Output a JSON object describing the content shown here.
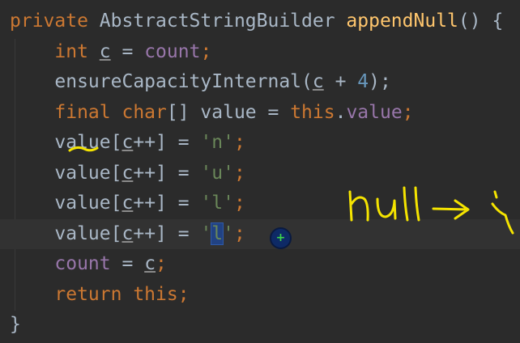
{
  "code": {
    "lines": [
      [
        {
          "t": "private ",
          "c": "kw"
        },
        {
          "t": "AbstractStringBuilder ",
          "c": "plain"
        },
        {
          "t": "appendNull",
          "c": "fn"
        },
        {
          "t": "() {",
          "c": "plain"
        }
      ],
      [
        {
          "t": "    ",
          "c": "plain"
        },
        {
          "t": "int ",
          "c": "kw"
        },
        {
          "t": "c",
          "c": "var"
        },
        {
          "t": " = ",
          "c": "plain"
        },
        {
          "t": "count",
          "c": "field"
        },
        {
          "t": ";",
          "c": "kw"
        }
      ],
      [
        {
          "t": "    ensureCapacityInternal(",
          "c": "plain"
        },
        {
          "t": "c",
          "c": "var"
        },
        {
          "t": " + ",
          "c": "plain"
        },
        {
          "t": "4",
          "c": "num"
        },
        {
          "t": ");",
          "c": "plain"
        }
      ],
      [
        {
          "t": "    ",
          "c": "plain"
        },
        {
          "t": "final char",
          "c": "kw"
        },
        {
          "t": "[] value = ",
          "c": "plain"
        },
        {
          "t": "this",
          "c": "kw"
        },
        {
          "t": ".",
          "c": "plain"
        },
        {
          "t": "value",
          "c": "field"
        },
        {
          "t": ";",
          "c": "kw"
        }
      ],
      [
        {
          "t": "    value[",
          "c": "plain"
        },
        {
          "t": "c",
          "c": "var"
        },
        {
          "t": "++] = ",
          "c": "plain"
        },
        {
          "t": "'n'",
          "c": "str"
        },
        {
          "t": ";",
          "c": "kw"
        }
      ],
      [
        {
          "t": "    value[",
          "c": "plain"
        },
        {
          "t": "c",
          "c": "var"
        },
        {
          "t": "++] = ",
          "c": "plain"
        },
        {
          "t": "'u'",
          "c": "str"
        },
        {
          "t": ";",
          "c": "kw"
        }
      ],
      [
        {
          "t": "    value[",
          "c": "plain"
        },
        {
          "t": "c",
          "c": "var"
        },
        {
          "t": "++] = ",
          "c": "plain"
        },
        {
          "t": "'l'",
          "c": "str"
        },
        {
          "t": ";",
          "c": "kw"
        }
      ],
      [
        {
          "t": "    value[",
          "c": "plain"
        },
        {
          "t": "c",
          "c": "var"
        },
        {
          "t": "++] = ",
          "c": "plain"
        },
        {
          "t": "'",
          "c": "str"
        },
        {
          "t": "l",
          "c": "str",
          "sel": true
        },
        {
          "t": "'",
          "c": "str"
        },
        {
          "t": ";",
          "c": "kw"
        }
      ],
      [
        {
          "t": "    ",
          "c": "plain"
        },
        {
          "t": "count",
          "c": "field"
        },
        {
          "t": " = ",
          "c": "plain"
        },
        {
          "t": "c",
          "c": "var"
        },
        {
          "t": ";",
          "c": "kw"
        }
      ],
      [
        {
          "t": "    ",
          "c": "plain"
        },
        {
          "t": "return this",
          "c": "kw"
        },
        {
          "t": ";",
          "c": "kw"
        }
      ],
      [
        {
          "t": "}",
          "c": "plain"
        }
      ]
    ],
    "current_line_index": 7
  },
  "annotation": {
    "handwriting": "null →",
    "ink_color": "#f5e400"
  },
  "cursor": {
    "icon": "plus-icon",
    "glyph": "+"
  }
}
